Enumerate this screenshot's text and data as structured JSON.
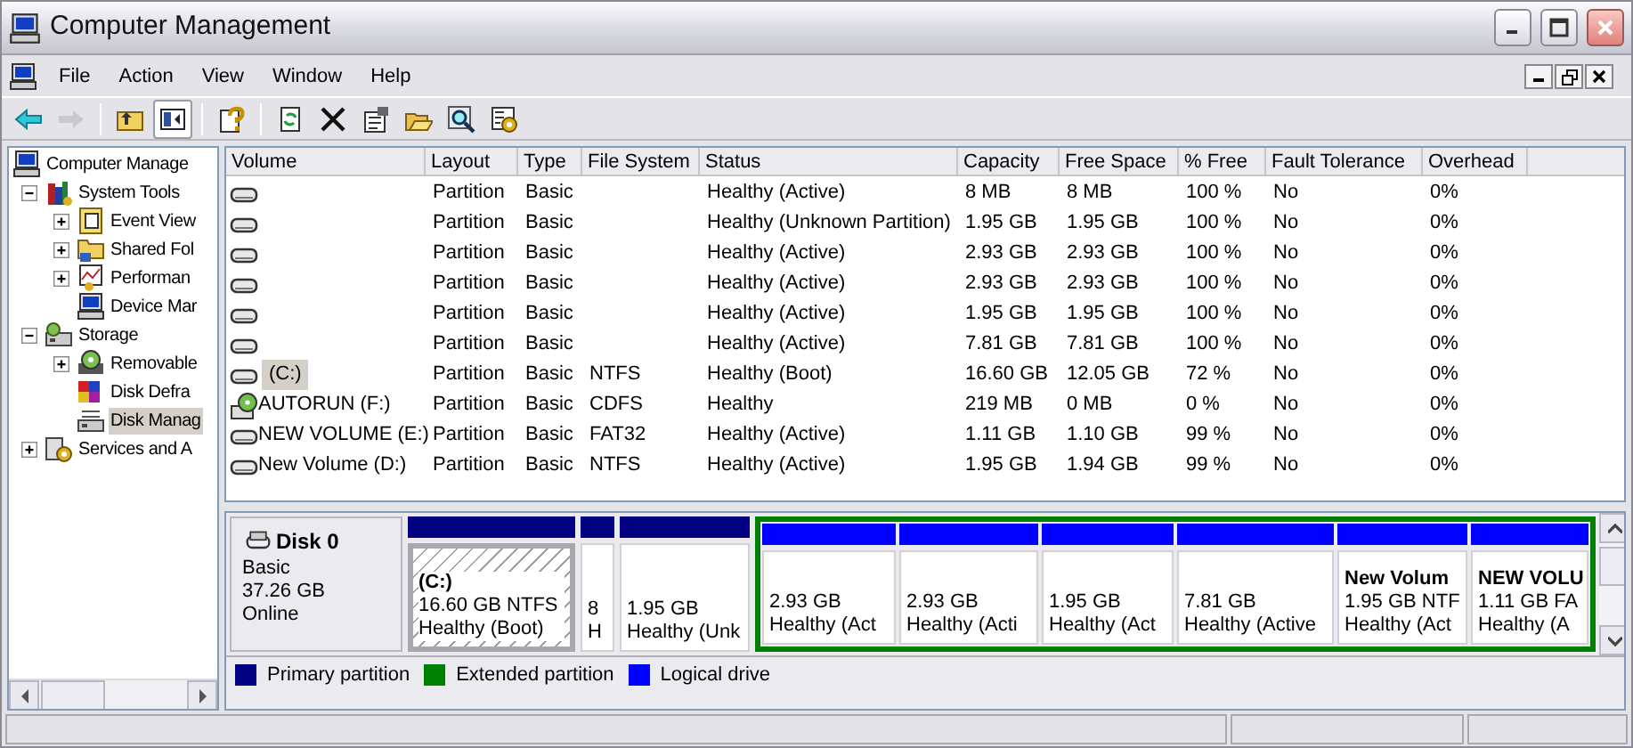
{
  "window": {
    "title": "Computer Management"
  },
  "menu": [
    "File",
    "Action",
    "View",
    "Window",
    "Help"
  ],
  "toolbar": [
    {
      "kind": "back",
      "disabled": false,
      "pressed": false
    },
    {
      "kind": "forward",
      "disabled": true,
      "pressed": false
    },
    {
      "kind": "separator"
    },
    {
      "kind": "up",
      "disabled": false,
      "pressed": false
    },
    {
      "kind": "tree",
      "disabled": false,
      "pressed": true
    },
    {
      "kind": "separator"
    },
    {
      "kind": "help",
      "disabled": false,
      "pressed": false
    },
    {
      "kind": "separator"
    },
    {
      "kind": "export",
      "disabled": false,
      "pressed": false
    },
    {
      "kind": "delete",
      "disabled": false,
      "pressed": false
    },
    {
      "kind": "properties",
      "disabled": false,
      "pressed": false
    },
    {
      "kind": "open",
      "disabled": false,
      "pressed": false
    },
    {
      "kind": "search",
      "disabled": false,
      "pressed": false
    },
    {
      "kind": "settings",
      "disabled": false,
      "pressed": false
    }
  ],
  "tree": [
    {
      "label": "Computer Manage",
      "kind": "computer",
      "selected": false,
      "children": [
        {
          "label": "System Tools",
          "kind": "tools",
          "selected": false,
          "expanded": true,
          "children": [
            {
              "label": "Event View",
              "kind": "event",
              "selected": false,
              "expanded": false
            },
            {
              "label": "Shared Fol",
              "kind": "share",
              "selected": false,
              "expanded": false
            },
            {
              "label": "Performan",
              "kind": "perf",
              "selected": false,
              "expanded": false
            },
            {
              "label": "Device Mar",
              "kind": "device",
              "selected": false
            }
          ]
        },
        {
          "label": "Storage",
          "kind": "storage",
          "selected": false,
          "expanded": true,
          "children": [
            {
              "label": "Removable",
              "kind": "removable",
              "selected": false,
              "expanded": false
            },
            {
              "label": "Disk Defra",
              "kind": "defrag",
              "selected": false
            },
            {
              "label": "Disk Manag",
              "kind": "diskmgmt",
              "selected": true
            }
          ]
        },
        {
          "label": "Services and A",
          "kind": "services",
          "selected": false,
          "expanded": false
        }
      ]
    }
  ],
  "table": {
    "columns": [
      "Volume",
      "Layout",
      "Type",
      "File System",
      "Status",
      "Capacity",
      "Free Space",
      "% Free",
      "Fault Tolerance",
      "Overhead"
    ],
    "rows": [
      {
        "kind": "disk",
        "selected": false,
        "layout": "Partition",
        "type": "Basic",
        "status": "Healthy (Active)",
        "capacity": "8 MB",
        "free_space": "8 MB",
        "percent_free": "100 %",
        "fault_tolerance": "No",
        "overhead": "0%"
      },
      {
        "kind": "disk",
        "selected": false,
        "layout": "Partition",
        "type": "Basic",
        "status": "Healthy (Unknown Partition)",
        "capacity": "1.95 GB",
        "free_space": "1.95 GB",
        "percent_free": "100 %",
        "fault_tolerance": "No",
        "overhead": "0%"
      },
      {
        "kind": "disk",
        "selected": false,
        "layout": "Partition",
        "type": "Basic",
        "status": "Healthy (Active)",
        "capacity": "2.93 GB",
        "free_space": "2.93 GB",
        "percent_free": "100 %",
        "fault_tolerance": "No",
        "overhead": "0%"
      },
      {
        "kind": "disk",
        "selected": false,
        "layout": "Partition",
        "type": "Basic",
        "status": "Healthy (Active)",
        "capacity": "2.93 GB",
        "free_space": "2.93 GB",
        "percent_free": "100 %",
        "fault_tolerance": "No",
        "overhead": "0%"
      },
      {
        "kind": "disk",
        "selected": false,
        "layout": "Partition",
        "type": "Basic",
        "status": "Healthy (Active)",
        "capacity": "1.95 GB",
        "free_space": "1.95 GB",
        "percent_free": "100 %",
        "fault_tolerance": "No",
        "overhead": "0%"
      },
      {
        "kind": "disk",
        "selected": false,
        "layout": "Partition",
        "type": "Basic",
        "status": "Healthy (Active)",
        "capacity": "7.81 GB",
        "free_space": "7.81 GB",
        "percent_free": "100 %",
        "fault_tolerance": "No",
        "overhead": "0%"
      },
      {
        "kind": "disk",
        "selected": true,
        "volume": "(C:)",
        "layout": "Partition",
        "type": "Basic",
        "file_system": "NTFS",
        "status": "Healthy (Boot)",
        "capacity": "16.60 GB",
        "free_space": "12.05 GB",
        "percent_free": "72 %",
        "fault_tolerance": "No",
        "overhead": "0%"
      },
      {
        "kind": "cd",
        "selected": false,
        "volume": "AUTORUN (F:)",
        "layout": "Partition",
        "type": "Basic",
        "file_system": "CDFS",
        "status": "Healthy",
        "capacity": "219 MB",
        "free_space": "0 MB",
        "percent_free": "0 %",
        "fault_tolerance": "No",
        "overhead": "0%"
      },
      {
        "kind": "disk",
        "selected": false,
        "volume": "NEW VOLUME (E:)",
        "layout": "Partition",
        "type": "Basic",
        "file_system": "FAT32",
        "status": "Healthy (Active)",
        "capacity": "1.11 GB",
        "free_space": "1.10 GB",
        "percent_free": "99 %",
        "fault_tolerance": "No",
        "overhead": "0%"
      },
      {
        "kind": "disk",
        "selected": false,
        "volume": "New Volume (D:)",
        "layout": "Partition",
        "type": "Basic",
        "file_system": "NTFS",
        "status": "Healthy (Active)",
        "capacity": "1.95 GB",
        "free_space": "1.94 GB",
        "percent_free": "99 %",
        "fault_tolerance": "No",
        "overhead": "0%"
      }
    ]
  },
  "disk": {
    "name": "Disk 0",
    "type": "Basic",
    "size": "37.26 GB",
    "state": "Online",
    "partitions": [
      {
        "kind": "primary",
        "selected": true,
        "name": "(C:)",
        "size": "16.60 GB NTFS",
        "status": "Healthy (Boot)"
      },
      {
        "kind": "primary",
        "selected": false,
        "size": "8",
        "status": "H"
      },
      {
        "kind": "primary",
        "selected": false,
        "size": "1.95 GB",
        "status": "Healthy (Unk"
      },
      {
        "kind": "extended",
        "children": [
          {
            "kind": "logical",
            "selected": false,
            "size": "2.93 GB",
            "status": "Healthy (Act"
          },
          {
            "kind": "logical",
            "selected": false,
            "size": "2.93 GB",
            "status": "Healthy (Acti"
          },
          {
            "kind": "logical",
            "selected": false,
            "size": "1.95 GB",
            "status": "Healthy (Act"
          },
          {
            "kind": "logical",
            "selected": false,
            "size": "7.81 GB",
            "status": "Healthy (Active"
          },
          {
            "kind": "logical",
            "selected": false,
            "name": "New Volum",
            "size": "1.95 GB NTF",
            "status": "Healthy (Act"
          },
          {
            "kind": "logical",
            "selected": false,
            "name": "NEW VOLU",
            "size": "1.11 GB FA",
            "status": "Healthy (A"
          }
        ]
      }
    ]
  },
  "legend": [
    {
      "label": "Primary partition",
      "color": "#000080"
    },
    {
      "label": "Extended partition",
      "color": "#008000"
    },
    {
      "label": "Logical drive",
      "color": "#0000ff"
    }
  ]
}
